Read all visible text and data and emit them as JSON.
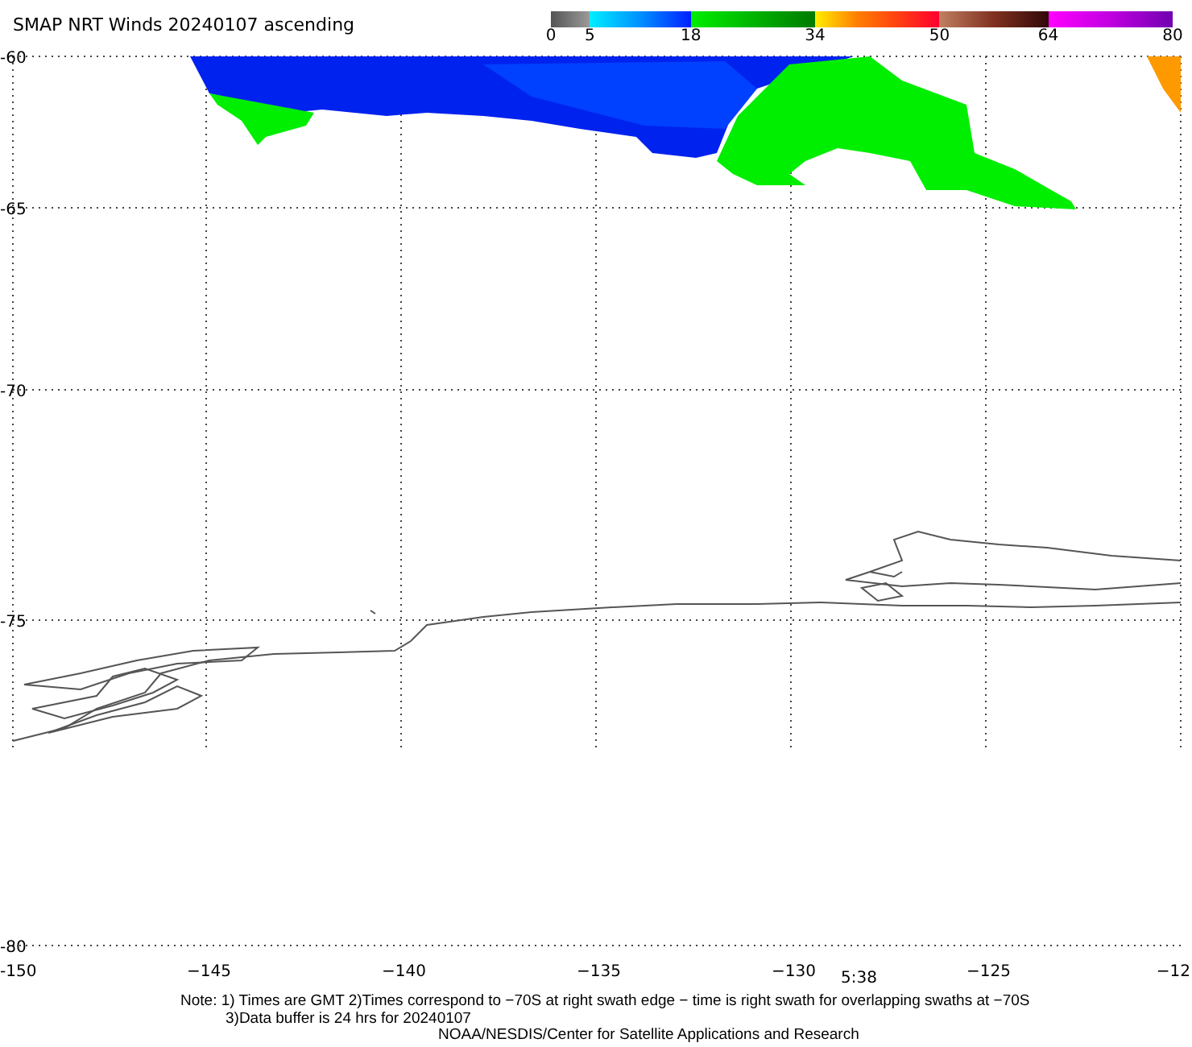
{
  "title": "SMAP NRT Winds 20240107 ascending",
  "colorbar": {
    "ticks": [
      "0",
      "5",
      "18",
      "34",
      "50",
      "64",
      "80"
    ]
  },
  "map": {
    "lat_labels": [
      "-60",
      "-65",
      "-70",
      "-75",
      "-80"
    ],
    "lon_labels": [
      "-150",
      "−145",
      "−140",
      "−135",
      "−130",
      "−125",
      "−12"
    ],
    "time_label": "5:38"
  },
  "notes": [
    "Note: 1) Times are GMT 2)Times correspond to −70S at right swath edge − time is right swath for overlapping swaths at −70S",
    "3)Data buffer is 24 hrs for 20240107",
    "NOAA/NESDIS/Center for Satellite Applications and Research"
  ]
}
